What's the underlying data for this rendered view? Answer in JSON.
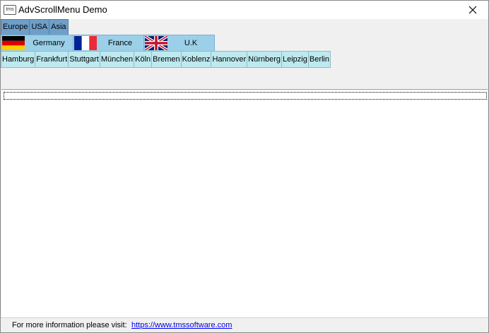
{
  "window": {
    "title": "AdvScrollMenu Demo",
    "app_icon_text": "tms"
  },
  "menu_level1": [
    "Europe",
    "USA",
    "Asia"
  ],
  "menu_level2": [
    {
      "label": "Germany",
      "flag": "germany-flag-icon"
    },
    {
      "label": "France",
      "flag": "france-flag-icon"
    },
    {
      "label": "U.K",
      "flag": "uk-flag-icon"
    }
  ],
  "menu_level3": [
    "Hamburg",
    "Frankfurt",
    "Stuttgart",
    "München",
    "Köln",
    "Bremen",
    "Koblenz",
    "Hannover",
    "Nürnberg",
    "Leipzig",
    "Berlin"
  ],
  "status": {
    "text": "For more information please visit:",
    "link": "https://www.tmssoftware.com"
  },
  "colors": {
    "level1_bg": "#6e9fc9",
    "level2_bg": "#9cd0e8",
    "level3_bg": "#bde9ef",
    "link": "#0000ee"
  }
}
